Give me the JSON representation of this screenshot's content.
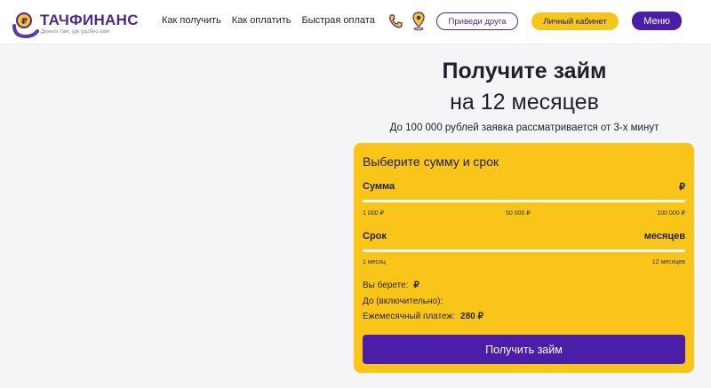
{
  "header": {
    "logo_title": "ТАЧФИНАНС",
    "logo_subtitle": "Деньги там, где удобно вам",
    "nav": [
      "Как получить",
      "Как оплатить",
      "Быстрая оплата"
    ],
    "invite_button": "Приведи друга",
    "cabinet_button": "Личный кабинет",
    "menu_button": "Меню",
    "icons": [
      "phone-icon",
      "location-pin-icon"
    ]
  },
  "hero": {
    "title": "Получите займ",
    "subtitle": "на 12 месяцев",
    "note": "До 100 000 рублей заявка рассматривается от 3-х минут"
  },
  "calculator": {
    "title": "Выберите сумму и срок",
    "amount": {
      "label": "Сумма",
      "unit": "₽",
      "ticks": [
        "1 000 ₽",
        "50 000 ₽",
        "100 000 ₽"
      ]
    },
    "term": {
      "label": "Срок",
      "unit": "месяцев",
      "ticks": [
        "1 месяц",
        "12 месяцев"
      ]
    },
    "summary": {
      "take_label": "Вы берете:",
      "take_value": "₽",
      "until_label": "До (включительно):",
      "monthly_label": "Ежемесячный платеж:",
      "monthly_value": "280 ₽"
    },
    "submit_button": "Получить займ"
  },
  "colors": {
    "brand_purple": "#4a1ea8",
    "accent_yellow": "#f8c518",
    "background": "#f5f5f7"
  }
}
